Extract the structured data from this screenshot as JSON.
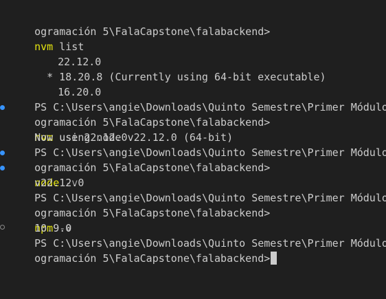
{
  "prompt_cont": "ogramación 5\\FalaCapstone\\falabackend>",
  "prompt_ps": "PS C:\\Users\\angie\\Downloads\\Quinto Semestre\\Primer Módulo\\Pr",
  "cmd1": {
    "name": "nvm",
    "args": " list"
  },
  "nvm_list": {
    "v1": "22.12.0",
    "v2": "* 18.20.8 (Currently using 64-bit executable)",
    "v3": "16.20.0"
  },
  "cmd2": {
    "name": "nvm",
    "args": " use 22.12.0"
  },
  "out2": "Now using node v22.12.0 (64-bit)",
  "cmd3": {
    "name": "node",
    "args": " -v"
  },
  "out3": "v22.12.0",
  "cmd4": {
    "name": "npm",
    "args": " -v"
  },
  "out4": "10.9.0",
  "colors": {
    "background": "#1f1f1f",
    "text": "#cccccc",
    "command": "#e5e510",
    "argument": "#a0a0a0",
    "success_decoration": "#3794ff",
    "neutral_decoration": "#8a8a8a"
  }
}
